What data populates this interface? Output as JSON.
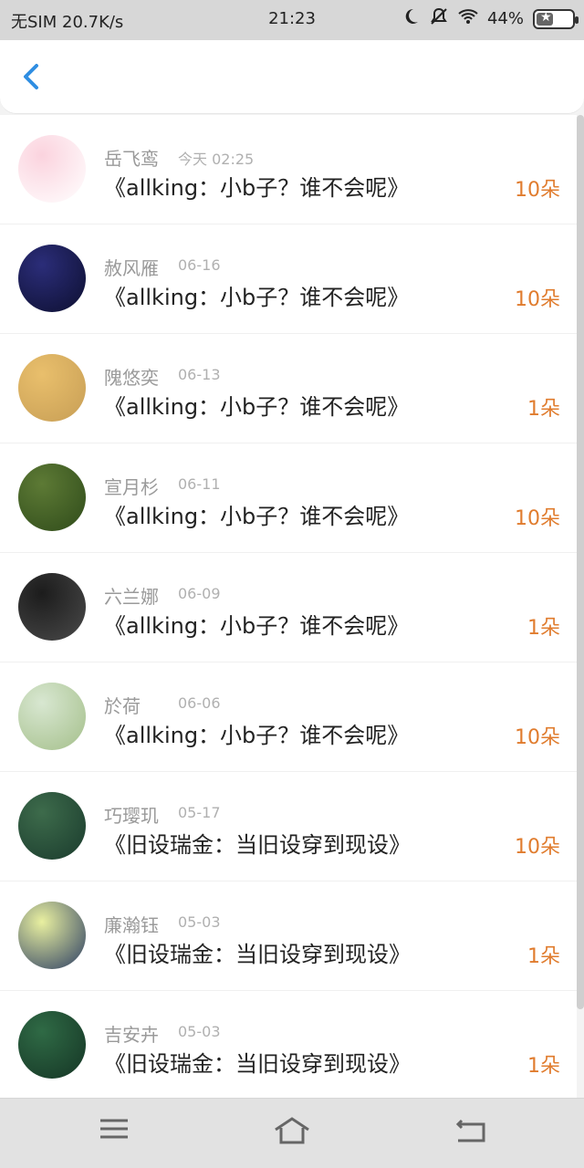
{
  "status_bar": {
    "carrier": "无SIM 20.7K/s",
    "time": "21:23",
    "battery": "44%"
  },
  "header": {
    "back_icon": "chevron-left-icon"
  },
  "items": [
    {
      "name": "岳飞鸾",
      "date": "今天 02:25",
      "title": "《allking：小b子？谁不会呢》",
      "amount": "10朵",
      "avatar_colors": [
        "#fbd3de",
        "#ffffff"
      ]
    },
    {
      "name": "赦风雁",
      "date": "06-16",
      "title": "《allking：小b子？谁不会呢》",
      "amount": "10朵",
      "avatar_colors": [
        "#2b2d79",
        "#0d0f30"
      ]
    },
    {
      "name": "隗悠奕",
      "date": "06-13",
      "title": "《allking：小b子？谁不会呢》",
      "amount": "1朵",
      "avatar_colors": [
        "#e9bf6c",
        "#c79e55"
      ]
    },
    {
      "name": "宣月杉",
      "date": "06-11",
      "title": "《allking：小b子？谁不会呢》",
      "amount": "10朵",
      "avatar_colors": [
        "#5d7a35",
        "#2f4b1a"
      ]
    },
    {
      "name": "六兰娜",
      "date": "06-09",
      "title": "《allking：小b子？谁不会呢》",
      "amount": "1朵",
      "avatar_colors": [
        "#1c1c1c",
        "#4a4a4a"
      ]
    },
    {
      "name": "於荷",
      "date": "06-06",
      "title": "《allking：小b子？谁不会呢》",
      "amount": "10朵",
      "avatar_colors": [
        "#d8e7d1",
        "#a4bf8a"
      ]
    },
    {
      "name": "巧璎玑",
      "date": "05-17",
      "title": "《旧设瑞金：当旧设穿到现设》",
      "amount": "10朵",
      "avatar_colors": [
        "#3d6b4b",
        "#1a3b2d"
      ]
    },
    {
      "name": "廉瀚钰",
      "date": "05-03",
      "title": "《旧设瑞金：当旧设穿到现设》",
      "amount": "1朵",
      "avatar_colors": [
        "#e9f0a0",
        "#2b3d63"
      ]
    },
    {
      "name": "吉安卉",
      "date": "05-03",
      "title": "《旧设瑞金：当旧设穿到现设》",
      "amount": "1朵",
      "avatar_colors": [
        "#2f6a45",
        "#153525"
      ]
    }
  ],
  "bottom_nav": {
    "menu_icon": "menu-icon",
    "home_icon": "home-icon",
    "back_icon": "back-icon"
  },
  "colors": {
    "amount": "#e07c2e",
    "accent": "#2f8ee2"
  }
}
